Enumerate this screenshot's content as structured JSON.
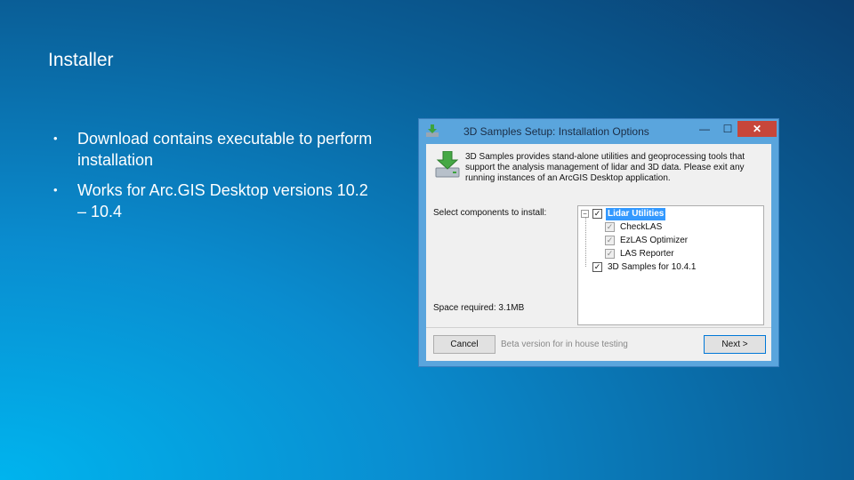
{
  "slide": {
    "title": "Installer",
    "bullets": [
      {
        "marker": "•",
        "text": "Download contains executable to perform installation"
      },
      {
        "marker": "•",
        "text": "Works for Arc.GIS Desktop versions 10.2 – 10.4"
      }
    ]
  },
  "dialog": {
    "title": "3D Samples Setup: Installation Options",
    "minimize_glyph": "—",
    "maximize_glyph": "☐",
    "close_glyph": "✕",
    "description": "3D Samples provides stand-alone utilities and geoprocessing tools that support the analysis management of lidar and 3D data. Please exit any running instances of an ArcGIS Desktop application.",
    "components_label": "Select components to install:",
    "tree": {
      "expander": "−",
      "check_glyph": "✓",
      "root": {
        "label": "Lidar Utilities",
        "checked": true,
        "selected": true
      },
      "children": [
        {
          "label": "CheckLAS",
          "checked": true
        },
        {
          "label": "EzLAS Optimizer",
          "checked": true
        },
        {
          "label": "LAS Reporter",
          "checked": true
        }
      ],
      "second": {
        "label": "3D Samples for 10.4.1",
        "checked": true
      }
    },
    "space_required": "Space required: 3.1MB",
    "cancel_label": "Cancel",
    "beta_note": "Beta version for in house testing",
    "next_label": "Next >"
  },
  "colors": {
    "background_dark": "#0b3f70",
    "background_light": "#00b4ee",
    "window_frame": "#5aa5dd",
    "close_button": "#c7463a",
    "selection": "#3399ff"
  }
}
